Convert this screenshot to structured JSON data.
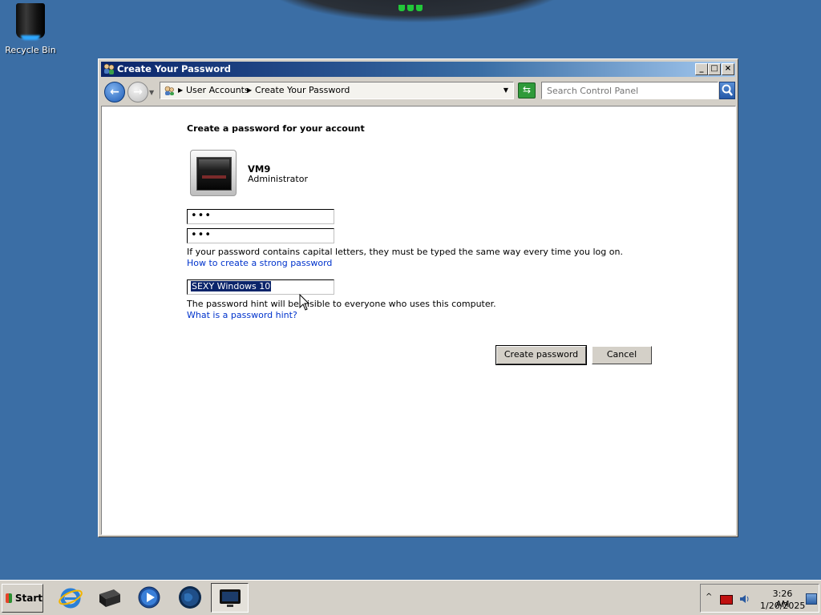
{
  "desktop": {
    "recycle_bin_label": "Recycle Bin"
  },
  "window": {
    "title": "Create Your Password",
    "buttons": {
      "minimize": "_",
      "maximize": "□",
      "close": "×"
    }
  },
  "addressbar": {
    "breadcrumbs": [
      "User Accounts",
      "Create Your Password"
    ],
    "search_placeholder": "Search Control Panel"
  },
  "form": {
    "heading": "Create a password for your account",
    "account": {
      "name": "VM9",
      "role": "Administrator"
    },
    "new_password_value": "•••",
    "confirm_password_value": "•••",
    "capital_letters_note": "If your password contains capital letters, they must be typed the same way every time you log on.",
    "strong_password_link": "How to create a strong password",
    "hint_value": "SEXY Windows 10",
    "hint_note": "The password hint will be visible to everyone who uses this computer.",
    "hint_link": "What is a password hint?",
    "create_button": "Create password",
    "cancel_button": "Cancel"
  },
  "taskbar": {
    "start_label": "Start",
    "pinned": [
      "internet-explorer-icon",
      "server-icon",
      "media-player-icon",
      "globe-icon",
      "monitor-icon"
    ],
    "clock": {
      "time": "3:26 AM",
      "date": "1/20/2025"
    }
  },
  "colors": {
    "desktop": "#3b6ea5",
    "titlebar_start": "#0a246a",
    "link": "#0033cc",
    "selection": "#0a246a"
  }
}
